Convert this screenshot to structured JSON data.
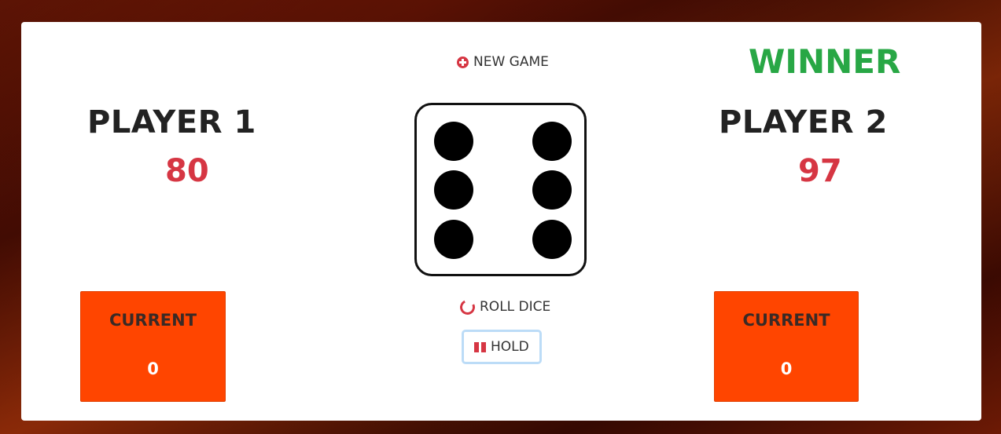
{
  "game": {
    "new_game_label": "NEW GAME",
    "roll_dice_label": "ROLL DICE",
    "hold_label": "HOLD",
    "dice_value": 6,
    "winner_label": "WINNER",
    "winner_player": 2
  },
  "players": [
    {
      "name": "PLAYER 1",
      "score": "80",
      "current_label": "CURRENT",
      "current_score": "0"
    },
    {
      "name": "PLAYER 2",
      "score": "97",
      "current_label": "CURRENT",
      "current_score": "0"
    }
  ],
  "colors": {
    "score_red": "#d63643",
    "current_box": "#ff4500",
    "winner_green": "#28a745",
    "icon_red": "#d63643"
  },
  "icons": {
    "new_game": "plus-circle-icon",
    "roll_dice": "spinner-icon",
    "hold": "pause-icon"
  }
}
